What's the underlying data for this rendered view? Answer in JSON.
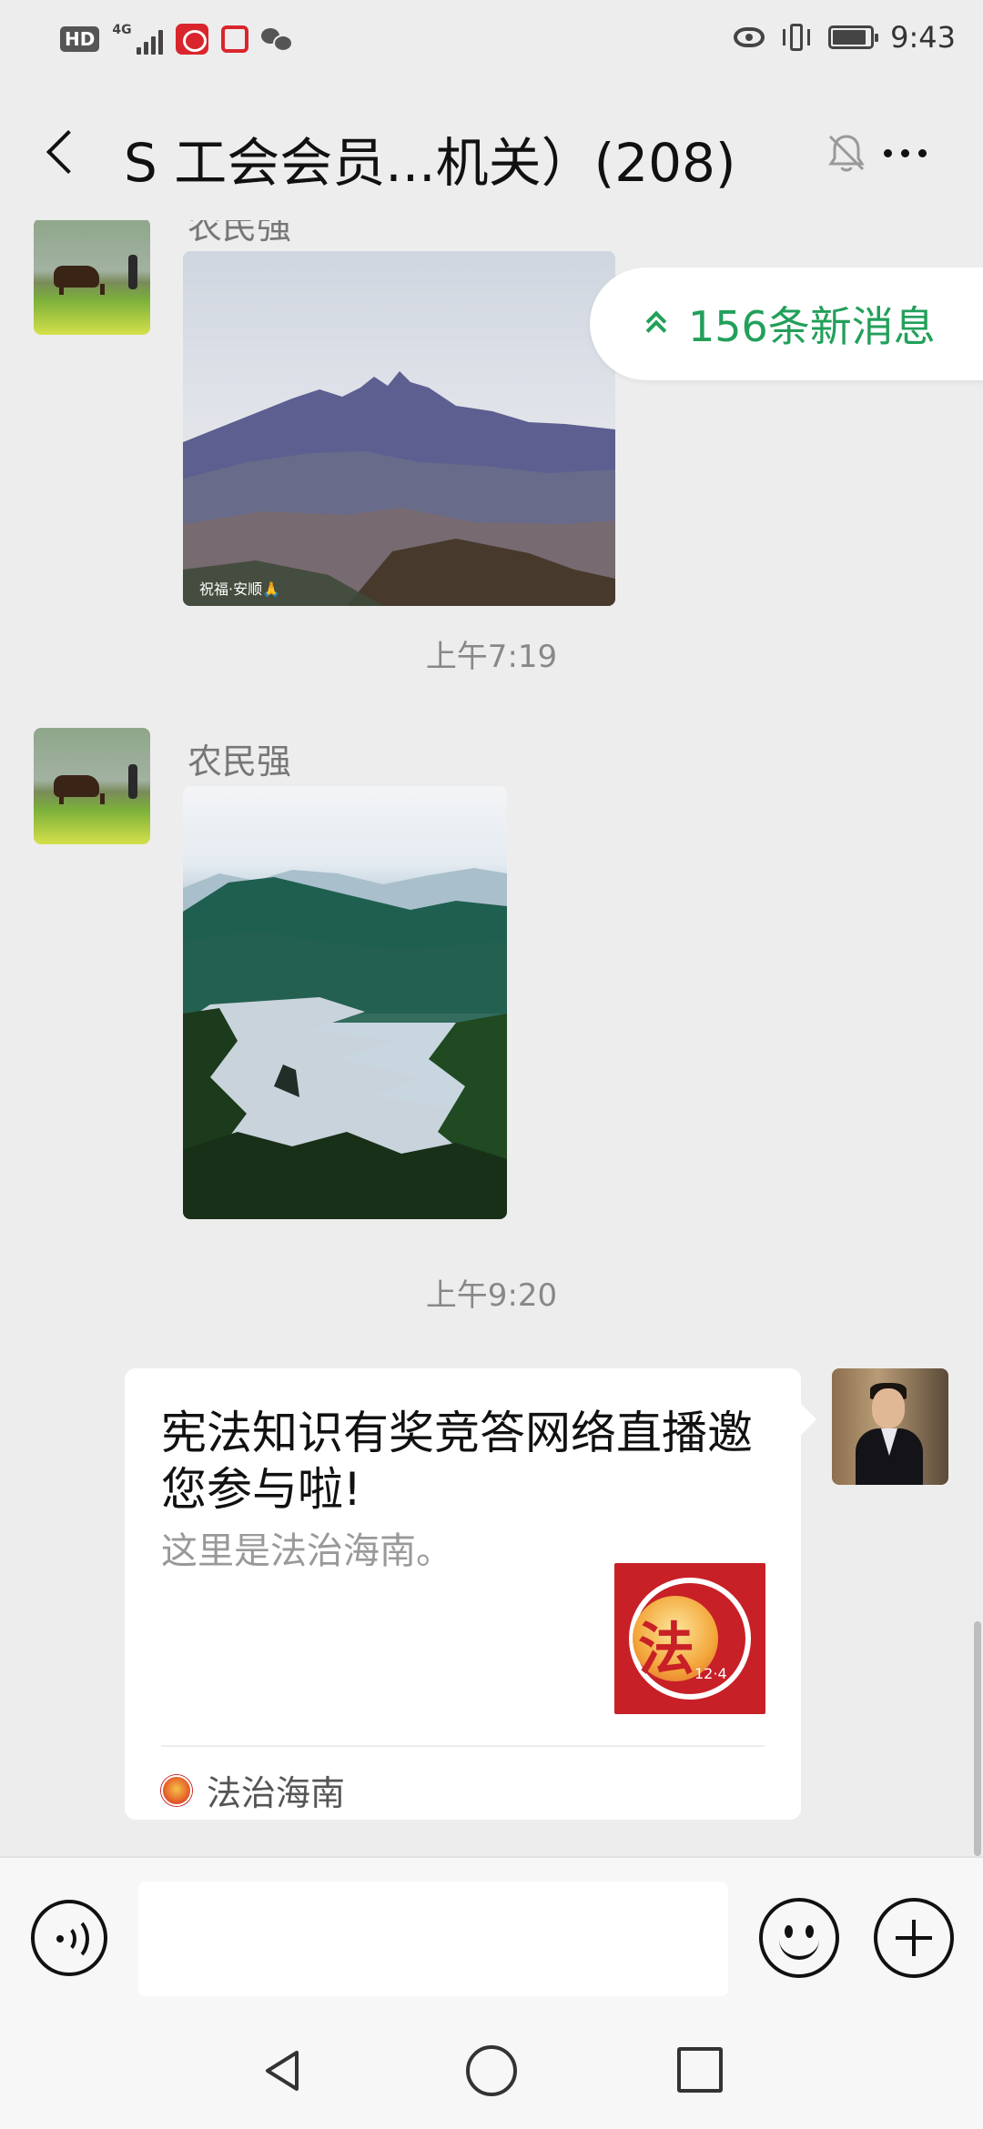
{
  "status_bar": {
    "network_badge": "HD",
    "network_type": "4G",
    "time": "9:43"
  },
  "header": {
    "title": "S 工会会员...机关）(208)",
    "icons": [
      "back-arrow-icon",
      "mute-bell-icon",
      "more-icon"
    ]
  },
  "new_messages": {
    "label": "156条新消息"
  },
  "messages": [
    {
      "sender": "农民强",
      "type": "image",
      "subject": "mountain",
      "watermark": "祝福·安顺🙏"
    },
    {
      "type": "timestamp",
      "text": "上午7:19"
    },
    {
      "sender": "农民强",
      "type": "image",
      "subject": "lake"
    },
    {
      "type": "timestamp",
      "text": "上午9:20"
    },
    {
      "type": "link_card",
      "title": "宪法知识有奖竞答网络直播邀您参与啦!",
      "description": "这里是法治海南。",
      "thumbnail_number": "12·4",
      "source": "法治海南"
    }
  ],
  "input_bar": {
    "placeholder": "",
    "icons": [
      "voice-icon",
      "emoji-icon",
      "plus-icon"
    ]
  },
  "nav_bar": {
    "icons": [
      "nav-back-icon",
      "nav-home-icon",
      "nav-recent-icon"
    ]
  },
  "colors": {
    "background": "#ededed",
    "accent_green": "#22a05a",
    "brand_red": "#c82027"
  }
}
